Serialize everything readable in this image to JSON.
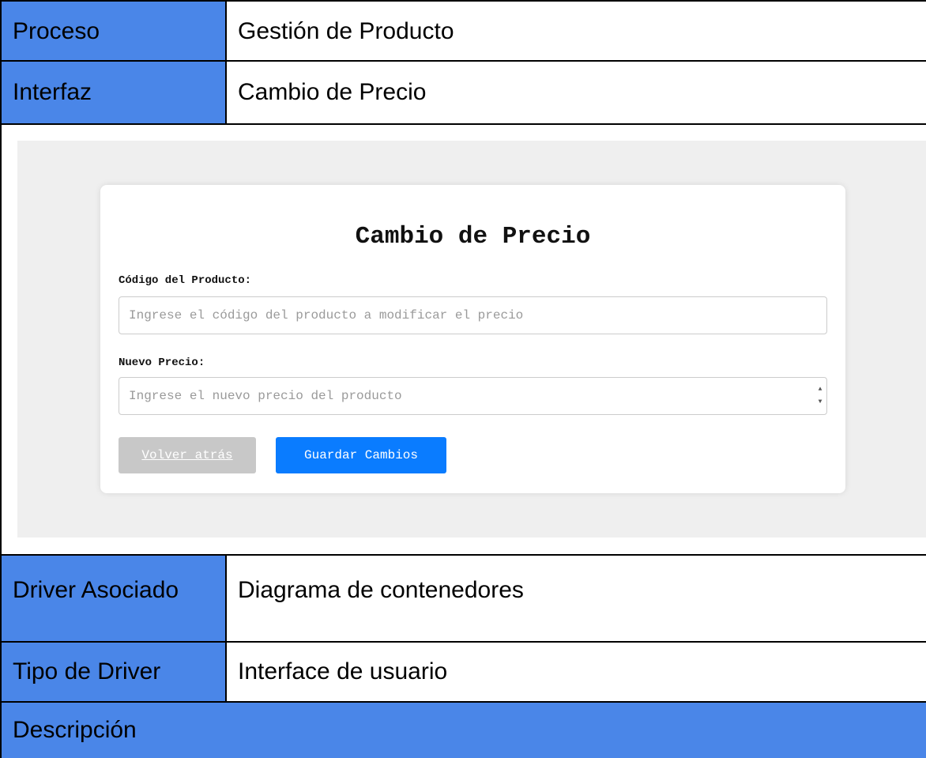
{
  "table": {
    "proceso_label": "Proceso",
    "proceso_value": "Gestión de Producto",
    "interfaz_label": "Interfaz",
    "interfaz_value": "Cambio de Precio",
    "driver_label": "Driver Asociado",
    "driver_value": "Diagrama de contenedores",
    "tipo_label": "Tipo de Driver",
    "tipo_value": "Interface de usuario",
    "descripcion_label": "Descripción"
  },
  "form": {
    "title": "Cambio de Precio",
    "codigo_label": "Código del Producto:",
    "codigo_placeholder": "Ingrese el código del producto a modificar el precio",
    "codigo_value": "",
    "precio_label": "Nuevo Precio:",
    "precio_placeholder": "Ingrese el nuevo precio del producto",
    "precio_value": "",
    "back_button": "Volver atrás",
    "save_button": "Guardar Cambios"
  },
  "colors": {
    "header_cell": "#4a86e8",
    "panel_bg": "#efefef",
    "primary_button": "#0a7cff",
    "disabled_button": "#c8c8c8"
  },
  "icons": {
    "spinner_up": "spinner-up-icon",
    "spinner_down": "spinner-down-icon"
  }
}
